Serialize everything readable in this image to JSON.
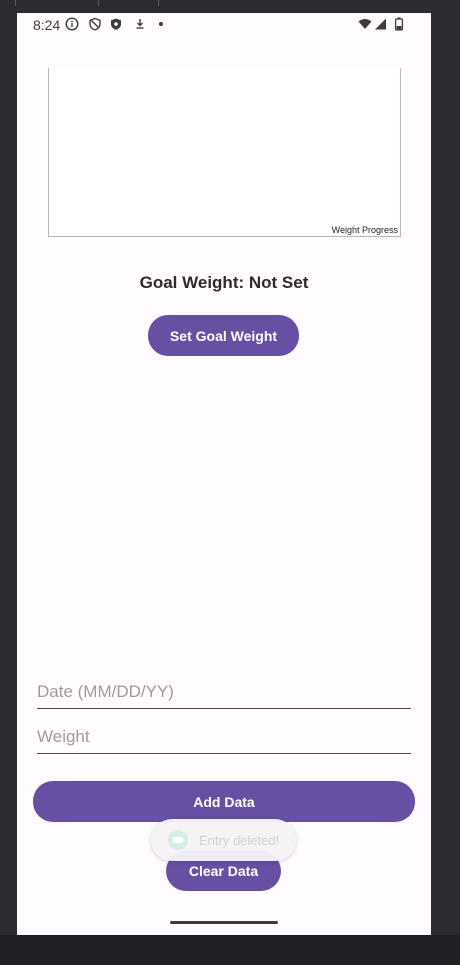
{
  "status_bar": {
    "time": "8:24",
    "icons_left": [
      "info-icon",
      "shield-icon",
      "shield-filled-icon",
      "download-icon",
      "dot-icon"
    ],
    "icons_right": [
      "wifi-icon",
      "signal-icon",
      "battery-icon"
    ]
  },
  "chart": {
    "description": "Weight Progress"
  },
  "goal": {
    "text": "Goal Weight: Not Set",
    "button_label": "Set Goal Weight"
  },
  "form": {
    "date_placeholder": "Date (MM/DD/YY)",
    "date_value": "",
    "weight_placeholder": "Weight",
    "weight_value": "",
    "add_label": "Add Data",
    "clear_label": "Clear Data"
  },
  "toast": {
    "text": "Entry deleted!"
  },
  "colors": {
    "primary": "#6750a4",
    "background": "#fffbfe"
  }
}
